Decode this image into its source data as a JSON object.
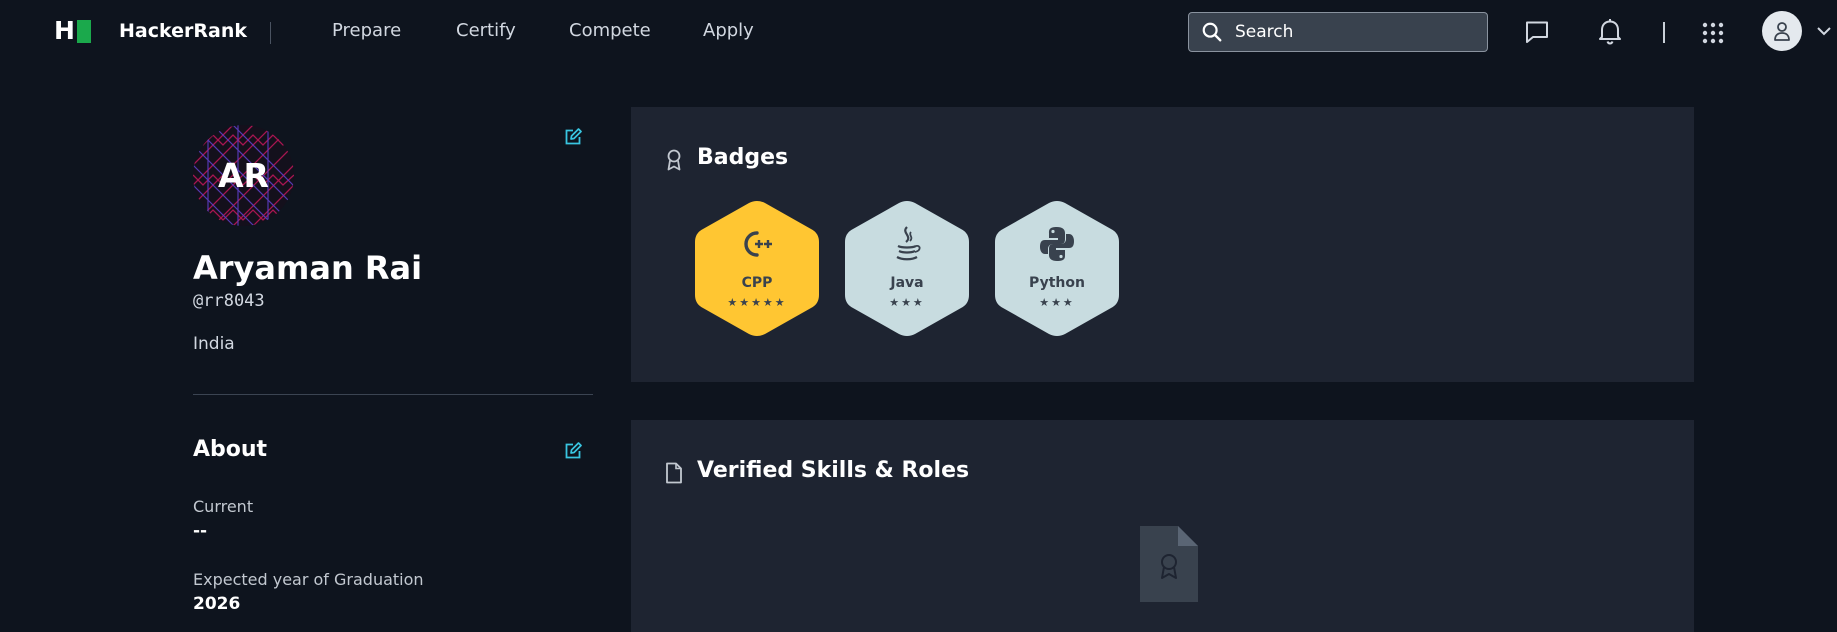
{
  "nav": {
    "brand": "HackerRank",
    "links": [
      "Prepare",
      "Certify",
      "Compete",
      "Apply"
    ],
    "search_placeholder": "Search"
  },
  "profile": {
    "initials": "AR",
    "name": "Aryaman Rai",
    "handle": "@rr8043",
    "country": "India"
  },
  "about": {
    "title": "About",
    "fields": [
      {
        "label": "Current",
        "value": "--"
      },
      {
        "label": "Expected year of Graduation",
        "value": "2026"
      }
    ]
  },
  "badges": {
    "title": "Badges",
    "items": [
      {
        "name": "CPP",
        "stars": "★★★★★",
        "color": "#ffc632",
        "icon": "cpp-icon"
      },
      {
        "name": "Java",
        "stars": "★★★",
        "color": "#c8dce0",
        "icon": "java-icon"
      },
      {
        "name": "Python",
        "stars": "★★★",
        "color": "#c8dce0",
        "icon": "python-icon"
      }
    ]
  },
  "skills": {
    "title": "Verified Skills & Roles"
  },
  "colors": {
    "background": "#0e141e",
    "card": "#1e2431",
    "brand_green": "#1ba94c",
    "gold_badge": "#ffc632",
    "silver_badge": "#c8dce0",
    "link": "#39c5e0"
  }
}
